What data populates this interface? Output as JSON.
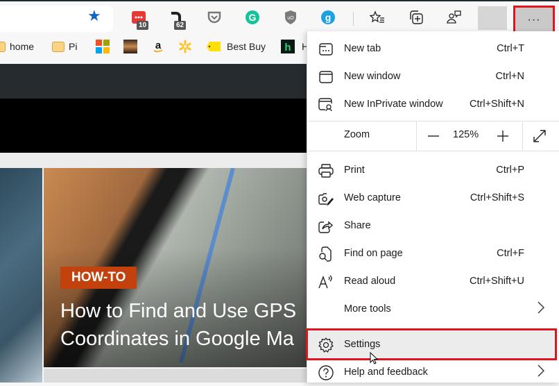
{
  "toolbar": {
    "favorite_icon": "star-filled",
    "extensions": [
      {
        "name": "todoist-extension",
        "badge": "10",
        "color": "#e53935"
      },
      {
        "name": "dashlane-extension",
        "badge": "62",
        "color": "#222222"
      },
      {
        "name": "pocket-extension",
        "badge": null,
        "color": "#777777"
      },
      {
        "name": "grammarly-extension",
        "badge": null,
        "color": "#15c39a"
      },
      {
        "name": "ublock-extension",
        "badge": null,
        "color": "#777777"
      },
      {
        "name": "grasshopper-extension",
        "badge": null,
        "color": "#1ba0e1"
      }
    ],
    "more_button_label": "···"
  },
  "bookmarks": [
    {
      "label": "home",
      "icon": "folder"
    },
    {
      "label": "Pi",
      "icon": "folder"
    },
    {
      "label": "",
      "icon": "microsoft"
    },
    {
      "label": "",
      "icon": "photo"
    },
    {
      "label": "",
      "icon": "amazon"
    },
    {
      "label": "",
      "icon": "walmart"
    },
    {
      "label": "Best Buy",
      "icon": "bestbuy-tag"
    },
    {
      "label": "H",
      "icon": "h-logo"
    }
  ],
  "page": {
    "category_badge": "HOW-TO",
    "headline_line1": "How to Find and Use GPS",
    "headline_line2": "Coordinates in Google Ma"
  },
  "menu": {
    "items": [
      {
        "label": "New tab",
        "shortcut": "Ctrl+T"
      },
      {
        "label": "New window",
        "shortcut": "Ctrl+N"
      },
      {
        "label": "New InPrivate window",
        "shortcut": "Ctrl+Shift+N"
      }
    ],
    "zoom": {
      "label": "Zoom",
      "value": "125%",
      "minus": "—",
      "plus": "+"
    },
    "items2": [
      {
        "label": "Print",
        "shortcut": "Ctrl+P"
      },
      {
        "label": "Web capture",
        "shortcut": "Ctrl+Shift+S"
      },
      {
        "label": "Share",
        "shortcut": ""
      },
      {
        "label": "Find on page",
        "shortcut": "Ctrl+F"
      },
      {
        "label": "Read aloud",
        "shortcut": "Ctrl+Shift+U"
      },
      {
        "label": "More tools",
        "shortcut": ""
      },
      {
        "label": "Settings",
        "shortcut": ""
      },
      {
        "label": "Help and feedback",
        "shortcut": ""
      }
    ],
    "highlight_color": "#e0141e"
  }
}
